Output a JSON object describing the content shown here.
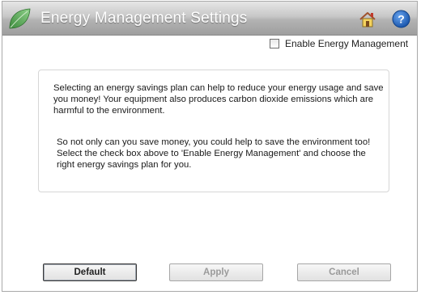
{
  "header": {
    "title": "Energy Management Settings",
    "icons": [
      "leaf-icon",
      "home-icon",
      "help-icon"
    ]
  },
  "enable": {
    "label": "Enable Energy Management",
    "checked": false
  },
  "info": {
    "paragraph_1": "Selecting an energy savings plan can help to reduce your energy usage and save you money! Your equipment also produces carbon dioxide emissions which are harmful to the environment.",
    "paragraph_2": "So not only can you save money, you could help to save the environment too! Select the check box above to 'Enable Energy Management' and choose the right energy savings plan for you."
  },
  "buttons": {
    "default_label": "Default",
    "apply_label": "Apply",
    "cancel_label": "Cancel"
  },
  "colors": {
    "leaf": "#4fa34f",
    "help": "#1f5fb8",
    "title_bar": "#b3b3b3"
  }
}
